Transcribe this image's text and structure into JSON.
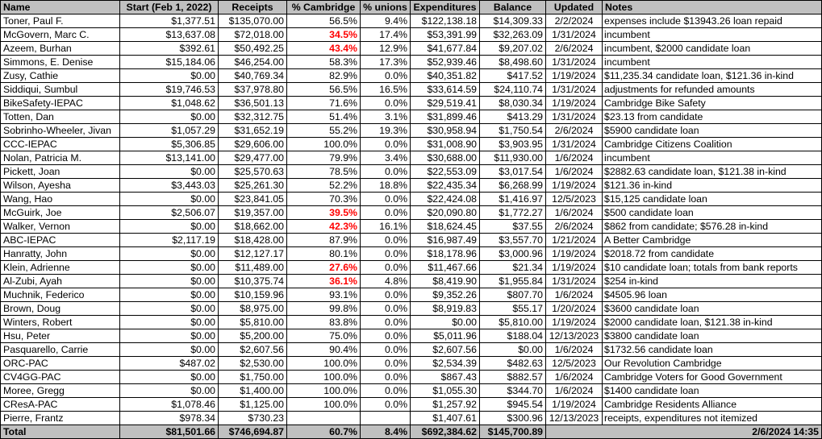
{
  "headers": [
    "Name",
    "Start (Feb 1, 2022)",
    "Receipts",
    "% Cambridge",
    "% unions",
    "Expenditures",
    "Balance",
    "Updated",
    "Notes"
  ],
  "rows": [
    {
      "name": "Toner, Paul F.",
      "start": "$1,377.51",
      "receipts": "$135,070.00",
      "cambridge": "56.5%",
      "unions": "9.4%",
      "expenditures": "$122,138.18",
      "balance": "$14,309.33",
      "updated": "2/2/2024",
      "notes": "expenses include $13943.26 loan repaid",
      "low": false
    },
    {
      "name": "McGovern, Marc C.",
      "start": "$13,637.08",
      "receipts": "$72,018.00",
      "cambridge": "34.5%",
      "unions": "17.4%",
      "expenditures": "$53,391.99",
      "balance": "$32,263.09",
      "updated": "1/31/2024",
      "notes": "incumbent",
      "low": true
    },
    {
      "name": "Azeem, Burhan",
      "start": "$392.61",
      "receipts": "$50,492.25",
      "cambridge": "43.4%",
      "unions": "12.9%",
      "expenditures": "$41,677.84",
      "balance": "$9,207.02",
      "updated": "2/6/2024",
      "notes": "incumbent, $2000 candidate loan",
      "low": true
    },
    {
      "name": "Simmons, E. Denise",
      "start": "$15,184.06",
      "receipts": "$46,254.00",
      "cambridge": "58.3%",
      "unions": "17.3%",
      "expenditures": "$52,939.46",
      "balance": "$8,498.60",
      "updated": "1/31/2024",
      "notes": "incumbent",
      "low": false
    },
    {
      "name": "Zusy, Cathie",
      "start": "$0.00",
      "receipts": "$40,769.34",
      "cambridge": "82.9%",
      "unions": "0.0%",
      "expenditures": "$40,351.82",
      "balance": "$417.52",
      "updated": "1/19/2024",
      "notes": "$11,235.34 candidate loan, $121.36 in-kind",
      "low": false
    },
    {
      "name": "Siddiqui, Sumbul",
      "start": "$19,746.53",
      "receipts": "$37,978.80",
      "cambridge": "56.5%",
      "unions": "16.5%",
      "expenditures": "$33,614.59",
      "balance": "$24,110.74",
      "updated": "1/31/2024",
      "notes": "adjustments for refunded amounts",
      "low": false
    },
    {
      "name": "BikeSafety-IEPAC",
      "start": "$1,048.62",
      "receipts": "$36,501.13",
      "cambridge": "71.6%",
      "unions": "0.0%",
      "expenditures": "$29,519.41",
      "balance": "$8,030.34",
      "updated": "1/19/2024",
      "notes": "Cambridge Bike Safety",
      "low": false
    },
    {
      "name": "Totten, Dan",
      "start": "$0.00",
      "receipts": "$32,312.75",
      "cambridge": "51.4%",
      "unions": "3.1%",
      "expenditures": "$31,899.46",
      "balance": "$413.29",
      "updated": "1/31/2024",
      "notes": "$23.13 from candidate",
      "low": false
    },
    {
      "name": "Sobrinho-Wheeler, Jivan",
      "start": "$1,057.29",
      "receipts": "$31,652.19",
      "cambridge": "55.2%",
      "unions": "19.3%",
      "expenditures": "$30,958.94",
      "balance": "$1,750.54",
      "updated": "2/6/2024",
      "notes": "$5900 candidate loan",
      "low": false
    },
    {
      "name": "CCC-IEPAC",
      "start": "$5,306.85",
      "receipts": "$29,606.00",
      "cambridge": "100.0%",
      "unions": "0.0%",
      "expenditures": "$31,008.90",
      "balance": "$3,903.95",
      "updated": "1/31/2024",
      "notes": "Cambridge Citizens Coalition",
      "low": false
    },
    {
      "name": "Nolan, Patricia M.",
      "start": "$13,141.00",
      "receipts": "$29,477.00",
      "cambridge": "79.9%",
      "unions": "3.4%",
      "expenditures": "$30,688.00",
      "balance": "$11,930.00",
      "updated": "1/6/2024",
      "notes": "incumbent",
      "low": false
    },
    {
      "name": "Pickett, Joan",
      "start": "$0.00",
      "receipts": "$25,570.63",
      "cambridge": "78.5%",
      "unions": "0.0%",
      "expenditures": "$22,553.09",
      "balance": "$3,017.54",
      "updated": "1/6/2024",
      "notes": "$2882.63 candidate loan, $121.38 in-kind",
      "low": false
    },
    {
      "name": "Wilson, Ayesha",
      "start": "$3,443.03",
      "receipts": "$25,261.30",
      "cambridge": "52.2%",
      "unions": "18.8%",
      "expenditures": "$22,435.34",
      "balance": "$6,268.99",
      "updated": "1/19/2024",
      "notes": " $121.36 in-kind",
      "low": false
    },
    {
      "name": "Wang, Hao",
      "start": "$0.00",
      "receipts": "$23,841.05",
      "cambridge": "70.3%",
      "unions": "0.0%",
      "expenditures": "$22,424.08",
      "balance": "$1,416.97",
      "updated": "12/5/2023",
      "notes": "$15,125 candidate loan",
      "low": false
    },
    {
      "name": "McGuirk, Joe",
      "start": "$2,506.07",
      "receipts": "$19,357.00",
      "cambridge": "39.5%",
      "unions": "0.0%",
      "expenditures": "$20,090.80",
      "balance": "$1,772.27",
      "updated": "1/6/2024",
      "notes": "$500 candidate loan",
      "low": true
    },
    {
      "name": "Walker, Vernon",
      "start": "$0.00",
      "receipts": "$18,662.00",
      "cambridge": "42.3%",
      "unions": "16.1%",
      "expenditures": "$18,624.45",
      "balance": "$37.55",
      "updated": "2/6/2024",
      "notes": "$862 from candidate; $576.28 in-kind",
      "low": true
    },
    {
      "name": "ABC-IEPAC",
      "start": "$2,117.19",
      "receipts": "$18,428.00",
      "cambridge": "87.9%",
      "unions": "0.0%",
      "expenditures": "$16,987.49",
      "balance": "$3,557.70",
      "updated": "1/21/2024",
      "notes": "A Better Cambridge",
      "low": false
    },
    {
      "name": "Hanratty, John",
      "start": "$0.00",
      "receipts": "$12,127.17",
      "cambridge": "80.1%",
      "unions": "0.0%",
      "expenditures": "$18,178.96",
      "balance": "$3,000.96",
      "updated": "1/19/2024",
      "notes": "$2018.72 from candidate",
      "low": false
    },
    {
      "name": "Klein, Adrienne",
      "start": "$0.00",
      "receipts": "$11,489.00",
      "cambridge": "27.6%",
      "unions": "0.0%",
      "expenditures": "$11,467.66",
      "balance": "$21.34",
      "updated": "1/19/2024",
      "notes": "$10 candidate loan; totals from bank reports",
      "low": true
    },
    {
      "name": "Al-Zubi, Ayah",
      "start": "$0.00",
      "receipts": "$10,375.74",
      "cambridge": "36.1%",
      "unions": "4.8%",
      "expenditures": "$8,419.90",
      "balance": "$1,955.84",
      "updated": "1/31/2024",
      "notes": "$254 in-kind",
      "low": true
    },
    {
      "name": "Muchnik, Federico",
      "start": "$0.00",
      "receipts": "$10,159.96",
      "cambridge": "93.1%",
      "unions": "0.0%",
      "expenditures": "$9,352.26",
      "balance": "$807.70",
      "updated": "1/6/2024",
      "notes": "$4505.96 loan",
      "low": false
    },
    {
      "name": "Brown, Doug",
      "start": "$0.00",
      "receipts": "$8,975.00",
      "cambridge": "99.8%",
      "unions": "0.0%",
      "expenditures": "$8,919.83",
      "balance": "$55.17",
      "updated": "1/20/2024",
      "notes": "$3600 candidate loan",
      "low": false
    },
    {
      "name": "Winters, Robert",
      "start": "$0.00",
      "receipts": "$5,810.00",
      "cambridge": "83.8%",
      "unions": "0.0%",
      "expenditures": "$0.00",
      "balance": "$5,810.00",
      "updated": "1/19/2024",
      "notes": "$2000 candidate loan, $121.38 in-kind",
      "low": false
    },
    {
      "name": "Hsu, Peter",
      "start": "$0.00",
      "receipts": "$5,200.00",
      "cambridge": "75.0%",
      "unions": "0.0%",
      "expenditures": "$5,011.96",
      "balance": "$188.04",
      "updated": "12/13/2023",
      "notes": "$3800 candidate loan",
      "low": false
    },
    {
      "name": "Pasquarello, Carrie",
      "start": "$0.00",
      "receipts": "$2,607.56",
      "cambridge": "90.4%",
      "unions": "0.0%",
      "expenditures": "$2,607.56",
      "balance": "$0.00",
      "updated": "1/6/2024",
      "notes": "$1732.56 candidate loan",
      "low": false
    },
    {
      "name": "ORC-PAC",
      "start": "$487.02",
      "receipts": "$2,530.00",
      "cambridge": "100.0%",
      "unions": "0.0%",
      "expenditures": "$2,534.39",
      "balance": "$482.63",
      "updated": "12/5/2023",
      "notes": "Our Revolution Cambridge",
      "low": false
    },
    {
      "name": "CV4GG-PAC",
      "start": "$0.00",
      "receipts": "$1,750.00",
      "cambridge": "100.0%",
      "unions": "0.0%",
      "expenditures": "$867.43",
      "balance": "$882.57",
      "updated": "1/6/2024",
      "notes": "Cambridge Voters for Good Government",
      "low": false
    },
    {
      "name": "Moree, Gregg",
      "start": "$0.00",
      "receipts": "$1,400.00",
      "cambridge": "100.0%",
      "unions": "0.0%",
      "expenditures": "$1,055.30",
      "balance": "$344.70",
      "updated": "1/6/2024",
      "notes": "$1400 candidate loan",
      "low": false
    },
    {
      "name": "CResA-PAC",
      "start": "$1,078.46",
      "receipts": "$1,125.00",
      "cambridge": "100.0%",
      "unions": "0.0%",
      "expenditures": "$1,257.92",
      "balance": "$945.54",
      "updated": "1/19/2024",
      "notes": "Cambridge Residents Alliance",
      "low": false
    },
    {
      "name": "Pierre, Frantz",
      "start": "$978.34",
      "receipts": "$730.23",
      "cambridge": "",
      "unions": "",
      "expenditures": "$1,407.61",
      "balance": "$300.96",
      "updated": "12/13/2023",
      "notes": "receipts, expenditures not itemized",
      "low": false
    }
  ],
  "total": {
    "label": "Total",
    "start": "$81,501.66",
    "receipts": "$746,694.87",
    "cambridge": "60.7%",
    "unions": "8.4%",
    "expenditures": "$692,384.62",
    "balance": "$145,700.89",
    "timestamp": "2/6/2024 14:35"
  },
  "colors": {
    "header_bg": "#c0c0c0",
    "low_cambridge": "#ff0000",
    "grid": "#000000"
  }
}
